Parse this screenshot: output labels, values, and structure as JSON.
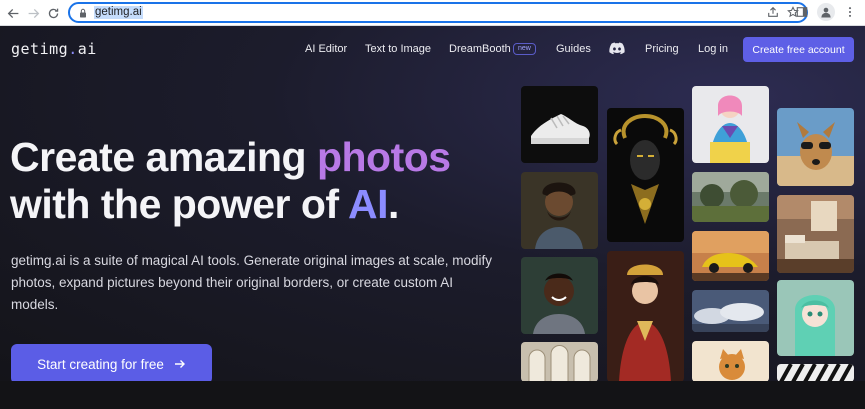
{
  "browser": {
    "url": "getimg.ai"
  },
  "site": {
    "logo_main": "getimg",
    "logo_dot": ".",
    "logo_suffix": "ai",
    "nav": {
      "ai_editor": "AI Editor",
      "text_to_image": "Text to Image",
      "dreambooth": "DreamBooth",
      "dreambooth_badge": "new",
      "guides": "Guides",
      "pricing": "Pricing",
      "login": "Log in",
      "cta": "Create free account"
    },
    "hero": {
      "title_part1": "Create amazing ",
      "title_highlight1": "photos",
      "title_part2": "with the power of ",
      "title_highlight2": "AI",
      "title_end": ".",
      "description": "getimg.ai is a suite of magical AI tools. Generate original images at scale, modify photos, expand pictures beyond their original borders, or create custom AI models.",
      "start_button": "Start creating for free"
    },
    "colors": {
      "accent": "#5e5fe6",
      "photos_highlight": "#b879e6",
      "ai_highlight": "#8c8cff",
      "background": "#1c1c2c"
    },
    "gallery": [
      "sneaker-image",
      "bearded-man-image",
      "smiling-man-image",
      "arched-hall-image",
      "golden-mask-image",
      "asian-woman-image",
      "pink-hair-girl-image",
      "landscape-image",
      "sports-car-image",
      "clouds-image",
      "cat-image",
      "dog-sunglasses-image",
      "bedroom-image",
      "anime-girl-image",
      "zebra-pattern-image"
    ]
  }
}
